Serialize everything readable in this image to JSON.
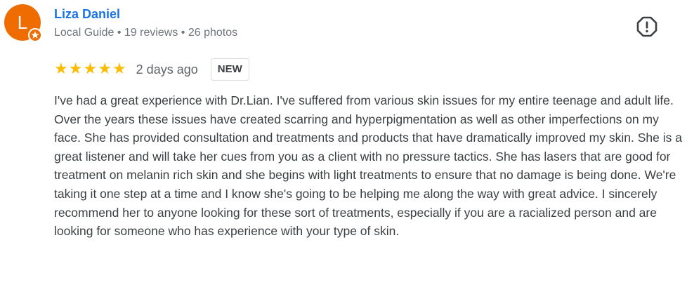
{
  "reviewer": {
    "avatar_initial": "L",
    "avatar_color": "#ef6c00",
    "name": "Liza Daniel",
    "meta": "Local Guide • 19 reviews • 26 photos",
    "badge_icon": "local-guide-star-icon"
  },
  "review": {
    "rating": 5,
    "rating_max": 5,
    "stars": [
      "★",
      "★",
      "★",
      "★",
      "★"
    ],
    "date": "2 days ago",
    "badge": "NEW",
    "text": "I've had a great experience with Dr.Lian. I've suffered from various skin issues for my entire teenage and adult life. Over the years these issues have created scarring and hyperpigmentation as well as other imperfections on my face. She has provided consultation and treatments and products that have dramatically improved my skin. She is a great listener and will take her cues from you as a client with no pressure tactics. She has lasers that are good for treatment on melanin rich skin and she begins with light treatments to ensure that no damage is being done. We're taking it one step at a time and I know she's going to be helping me along the way with great advice. I sincerely recommend her to anyone looking for these sort of treatments, especially if you are a racialized person and are looking for someone who has experience with your type of skin."
  },
  "actions": {
    "report_icon": "report-icon"
  },
  "colors": {
    "name_link": "#1a73e8",
    "star": "#fbbc04",
    "secondary_text": "#70757a",
    "body_text": "#3c4043"
  }
}
